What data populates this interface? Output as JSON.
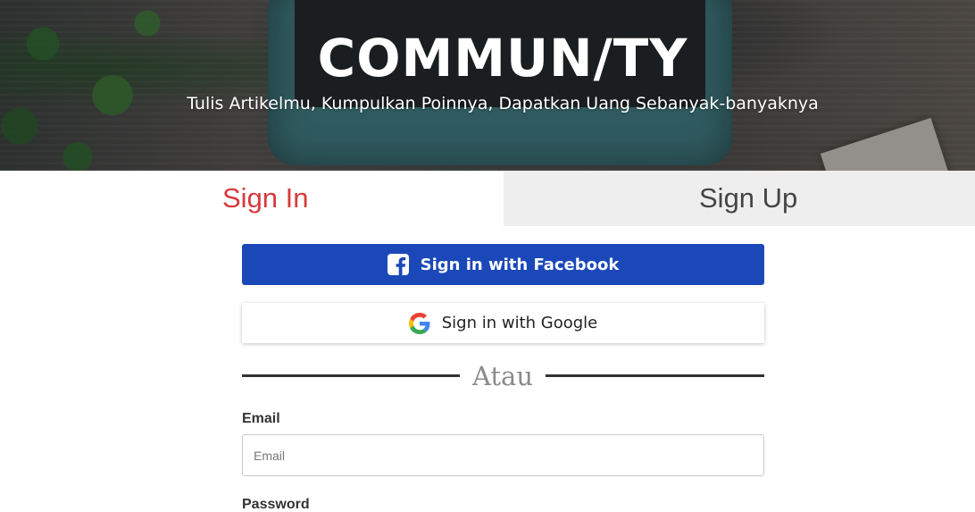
{
  "hero": {
    "brand": "COMMUN/TY",
    "tagline": "Tulis Artikelmu, Kumpulkan Poinnya, Dapatkan Uang Sebanyak-banyaknya"
  },
  "tabs": [
    {
      "label": "Sign In",
      "active": true
    },
    {
      "label": "Sign Up",
      "active": false
    }
  ],
  "social": {
    "facebook_label": "Sign in with Facebook",
    "google_label": "Sign in with Google"
  },
  "divider": {
    "text": "Atau"
  },
  "form": {
    "email_label": "Email",
    "email_placeholder": "Email",
    "email_value": "",
    "password_label": "Password"
  },
  "colors": {
    "accent": "#d7393d",
    "facebook": "#1b48b9",
    "tab_inactive_bg": "#eeeeee"
  },
  "icons": {
    "facebook": "facebook-icon",
    "google": "google-icon"
  }
}
